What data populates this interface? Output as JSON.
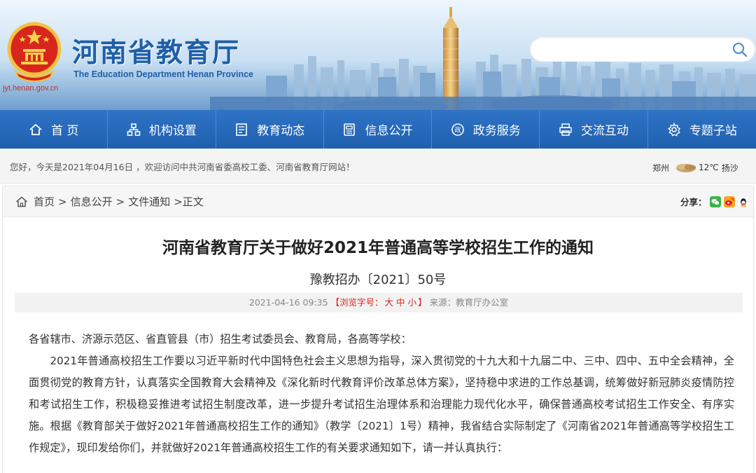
{
  "header": {
    "site_title": "河南省教育厅",
    "site_subtitle": "The Education Department Henan Province",
    "site_url": "jyt.henan.gov.cn",
    "search_placeholder": "",
    "brand_color": "#1f5fa8",
    "nav_color": "#2a6bbe"
  },
  "nav": {
    "items": [
      {
        "label": "首 页",
        "icon": "home-icon"
      },
      {
        "label": "机构设置",
        "icon": "org-chart-icon"
      },
      {
        "label": "教育动态",
        "icon": "news-icon"
      },
      {
        "label": "信息公开",
        "icon": "document-icon"
      },
      {
        "label": "政务服务",
        "icon": "service-icon"
      },
      {
        "label": "交流互动",
        "icon": "printer-icon"
      },
      {
        "label": "专题子站",
        "icon": "settings-icon"
      }
    ]
  },
  "welcome": {
    "text": "您好，今天是2021年04月16日 ，欢迎访问中共河南省委高校工委、河南省教育厅网站！",
    "weather_city": "郑州",
    "weather_temp": "12℃",
    "weather_desc": "扬沙"
  },
  "breadcrumb": {
    "items": [
      "首页",
      "信息公开",
      "文件通知"
    ],
    "current": "正文",
    "separator": ">"
  },
  "share": {
    "label": "分享："
  },
  "article": {
    "title": "河南省教育厅关于做好2021年普通高等学校招生工作的通知",
    "doc_number": "豫教招办〔2021〕50号",
    "date": "2021-04-16 09:35",
    "font_size_prefix": "【浏览字号：",
    "font_large": "大",
    "font_medium": "中",
    "font_small": "小",
    "font_size_suffix": "】",
    "source": "来源：教育厅办公室",
    "salutation": "各省辖市、济源示范区、省直管县（市）招生考试委员会、教育局，各高等学校：",
    "paragraph1": "2021年普通高校招生工作要以习近平新时代中国特色社会主义思想为指导，深入贯彻党的十九大和十九届二中、三中、四中、五中全会精神，全面贯彻党的教育方针，认真落实全国教育大会精神及《深化新时代教育评价改革总体方案》，坚持稳中求进的工作总基调，统筹做好新冠肺炎疫情防控和考试招生工作，积极稳妥推进考试招生制度改革，进一步提升考试招生治理体系和治理能力现代化水平，确保普通高校考试招生工作安全、有序实施。根据《教育部关于做好2021年普通高校招生工作的通知》（教学〔2021〕1号）精神，我省结合实际制定了《河南省2021年普通高等学校招生工作规定》，现印发给你们，并就做好2021年普通高校招生工作的有关要求通知如下，请一并认真执行："
  }
}
